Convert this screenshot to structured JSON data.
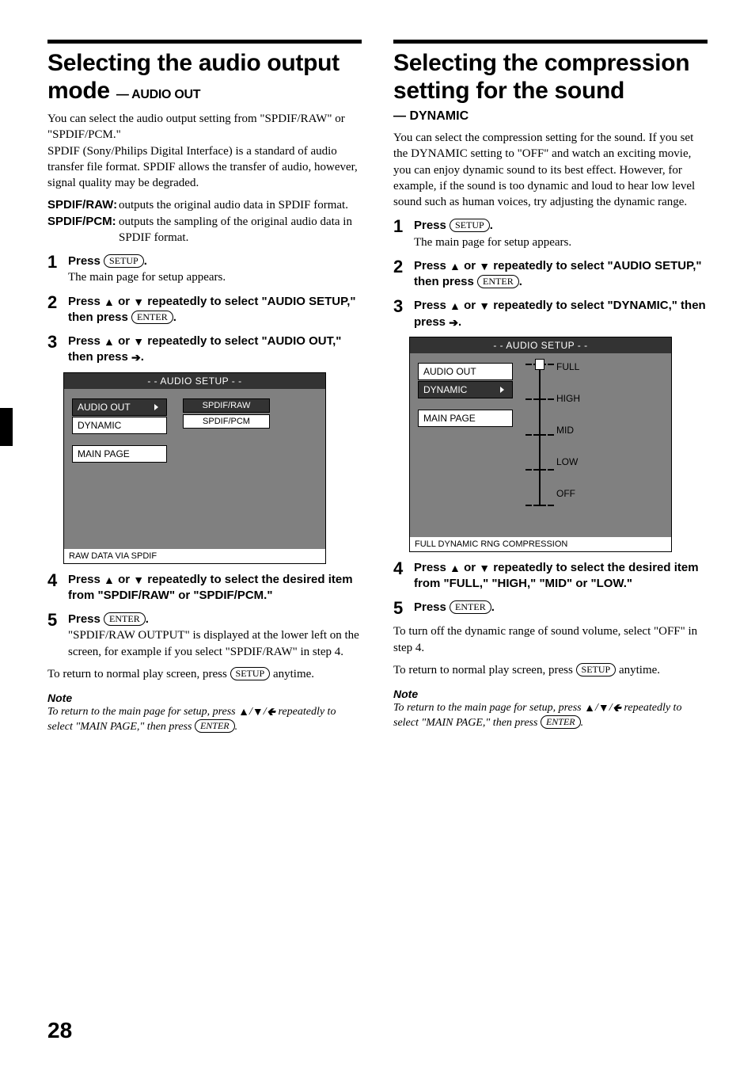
{
  "left": {
    "title_line1": "Selecting the audio output",
    "title_line2": "mode",
    "subtitle_prefix": " — ",
    "subtitle": "AUDIO OUT",
    "intro": "You can select the audio output setting from \"SPDIF/RAW\" or \"SPDIF/PCM.\"\nSPDIF (Sony/Philips Digital Interface) is a standard of audio transfer file format. SPDIF allows the transfer of audio, however, signal quality may be degraded.",
    "defs": [
      {
        "term": "SPDIF/RAW:",
        "desc": "outputs the original audio data in SPDIF format."
      },
      {
        "term": "SPDIF/PCM:",
        "desc": "outputs the sampling of the original audio data in SPDIF format."
      }
    ],
    "steps": [
      {
        "n": "1",
        "pre": "Press ",
        "key": "SETUP",
        "post": ".",
        "sub": "The main page for setup appears."
      },
      {
        "n": "2",
        "text_a": "Press ",
        "text_b": " or ",
        "text_c": " repeatedly to select \"AUDIO SETUP,\" then press ",
        "key": "ENTER",
        "post": "."
      },
      {
        "n": "3",
        "text_a": "Press ",
        "text_b": " or ",
        "text_c": " repeatedly to select \"AUDIO OUT,\" then press ",
        "arrow_right": true,
        "post": "."
      },
      {
        "n": "4",
        "text_a": "Press ",
        "text_b": " or ",
        "text_c": " repeatedly to select the desired item from \"SPDIF/RAW\" or \"SPDIF/PCM.\""
      },
      {
        "n": "5",
        "pre": "Press ",
        "key": "ENTER",
        "post": ".",
        "sub": "\"SPDIF/RAW OUTPUT\" is displayed at the lower left on the screen, for example if you select \"SPDIF/RAW\" in step 4."
      }
    ],
    "osd": {
      "title": "- - AUDIO SETUP - -",
      "left_items": [
        {
          "label": "AUDIO OUT",
          "selected": true,
          "arrow": true
        },
        {
          "label": "DYNAMIC"
        },
        {
          "label": "MAIN PAGE",
          "gap": true
        }
      ],
      "right_items": [
        {
          "label": "SPDIF/RAW",
          "selected": true
        },
        {
          "label": "SPDIF/PCM"
        }
      ],
      "status": "RAW DATA VIA SPDIF"
    },
    "return_text_a": "To return to normal play screen, press ",
    "return_key": "SETUP",
    "return_text_b": " anytime.",
    "note_hd": "Note",
    "note_a": "To return to the main page for setup, press ",
    "note_b": " repeatedly to select \"MAIN PAGE,\" then press ",
    "note_key": "ENTER",
    "note_c": "."
  },
  "right": {
    "title_line1": "Selecting the compression",
    "title_line2": "setting for the sound",
    "subtitle_prefix": "— ",
    "subtitle": "DYNAMIC",
    "intro": "You can select the compression setting for the sound. If you set the DYNAMIC setting to \"OFF\" and watch an exciting movie, you can enjoy dynamic sound to its best effect. However, for example, if the sound is too dynamic and loud to hear low level sound such as human voices, try adjusting the dynamic range.",
    "steps": [
      {
        "n": "1",
        "pre": "Press ",
        "key": "SETUP",
        "post": ".",
        "sub": "The main page for setup appears."
      },
      {
        "n": "2",
        "text_a": "Press ",
        "text_b": " or ",
        "text_c": " repeatedly to select \"AUDIO SETUP,\" then press ",
        "key": "ENTER",
        "post": "."
      },
      {
        "n": "3",
        "text_a": "Press ",
        "text_b": " or ",
        "text_c": " repeatedly to select \"DYNAMIC,\" then press ",
        "arrow_right": true,
        "post": "."
      },
      {
        "n": "4",
        "text_a": "Press ",
        "text_b": " or ",
        "text_c": " repeatedly to select the desired item from \"FULL,\" \"HIGH,\" \"MID\" or \"LOW.\""
      },
      {
        "n": "5",
        "pre": "Press ",
        "key": "ENTER",
        "post": "."
      }
    ],
    "osd": {
      "title": "- - AUDIO SETUP - -",
      "left_items": [
        {
          "label": "AUDIO OUT"
        },
        {
          "label": "DYNAMIC",
          "selected": true,
          "arrow": true
        },
        {
          "label": "MAIN PAGE",
          "gap": true
        }
      ],
      "slider_labels": [
        "FULL",
        "HIGH",
        "MID",
        "LOW",
        "OFF"
      ],
      "status": "FULL DYNAMIC RNG COMPRESSION"
    },
    "off_text": "To turn off the dynamic range of sound volume, select \"OFF\" in step 4.",
    "return_text_a": "To return to normal play screen, press ",
    "return_key": "SETUP",
    "return_text_b": " anytime.",
    "note_hd": "Note",
    "note_a": "To return to the main page for setup, press ",
    "note_b": " repeatedly to select \"MAIN PAGE,\" then press ",
    "note_key": "ENTER",
    "note_c": "."
  },
  "page_number": "28"
}
